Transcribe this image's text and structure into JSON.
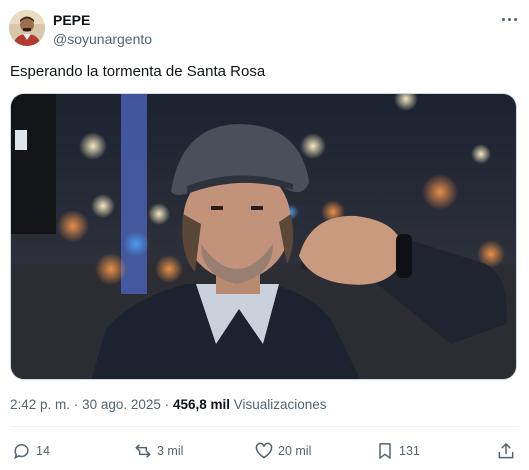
{
  "author": {
    "display_name": "PEPE",
    "handle": "@soyunargento",
    "avatar_icon": "profile-photo"
  },
  "tweet": {
    "text": "Esperando la tormenta de Santa Rosa",
    "media_icon": "photo-man-in-cap-checking-wrist-on-city-street-at-night"
  },
  "meta": {
    "time": "2:42 p. m.",
    "separator": "·",
    "date": "30 ago. 2025",
    "views_count": "456,8 mil",
    "views_label": "Visualizaciones"
  },
  "actions": {
    "replies": "14",
    "reposts": "3 mil",
    "likes": "20 mil",
    "bookmarks": "131"
  },
  "colors": {
    "text_primary": "#0f1419",
    "text_secondary": "#536471",
    "divider": "#eff3f4"
  }
}
